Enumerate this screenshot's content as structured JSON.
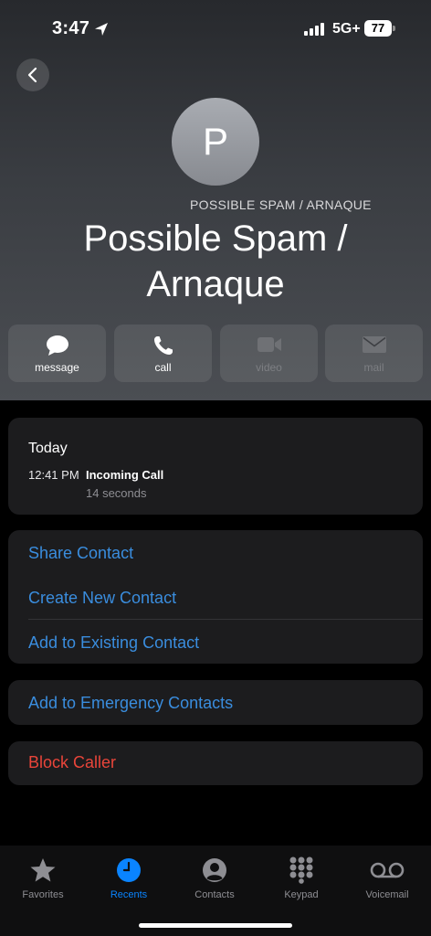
{
  "status_bar": {
    "time": "3:47",
    "network": "5G+",
    "battery": "77"
  },
  "contact": {
    "initial": "P",
    "subtitle": "POSSIBLE SPAM / ARNAQUE",
    "name_line1": "Possible Spam /",
    "name_line2": "Arnaque"
  },
  "actions": [
    {
      "label": "message",
      "icon": "message-bubble-icon",
      "enabled": true
    },
    {
      "label": "call",
      "icon": "phone-icon",
      "enabled": true
    },
    {
      "label": "video",
      "icon": "video-camera-icon",
      "enabled": false
    },
    {
      "label": "mail",
      "icon": "envelope-icon",
      "enabled": false
    }
  ],
  "recent": {
    "day": "Today",
    "time": "12:41 PM",
    "type": "Incoming Call",
    "duration": "14 seconds"
  },
  "options": {
    "share": "Share Contact",
    "create": "Create New Contact",
    "add_existing": "Add to Existing Contact",
    "emergency": "Add to Emergency Contacts",
    "block": "Block Caller"
  },
  "tabs": [
    {
      "label": "Favorites",
      "icon": "star-icon",
      "active": false
    },
    {
      "label": "Recents",
      "icon": "clock-icon",
      "active": true
    },
    {
      "label": "Contacts",
      "icon": "person-icon",
      "active": false
    },
    {
      "label": "Keypad",
      "icon": "keypad-icon",
      "active": false
    },
    {
      "label": "Voicemail",
      "icon": "voicemail-icon",
      "active": false
    }
  ],
  "colors": {
    "link": "#3a8dde",
    "destructive": "#e9453a",
    "tab_active": "#0a84ff"
  }
}
